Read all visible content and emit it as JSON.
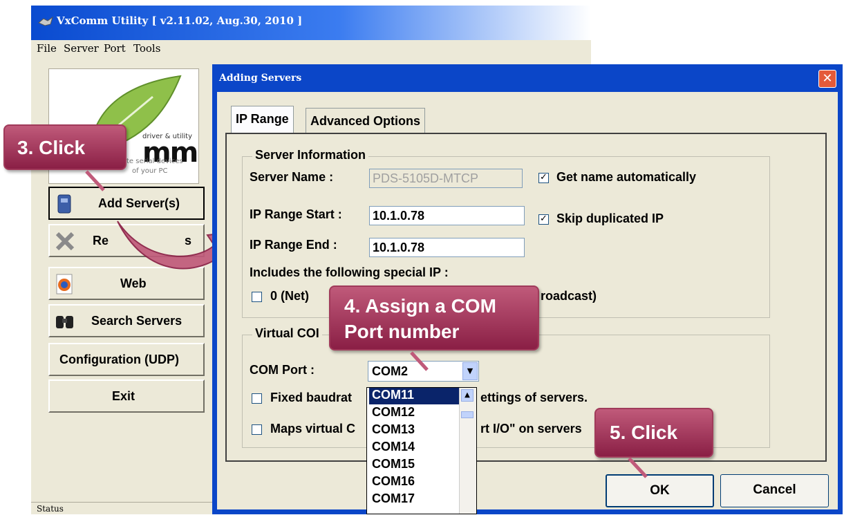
{
  "main_window": {
    "title": "VxComm Utility [ v2.11.02, Aug.30, 2010 ]",
    "menu": [
      "File",
      "Server",
      "Port",
      "Tools"
    ],
    "logo": {
      "tag": "driver & utility",
      "brand_partial": "mm",
      "line1": "te serial devices",
      "line2": "of your PC"
    },
    "sidebar": {
      "add_server": "Add Server(s)",
      "remove_partial_left": "Re",
      "remove_partial_right": "s",
      "web": "Web",
      "search_servers": "Search Servers",
      "configuration": "Configuration (UDP)",
      "exit": "Exit"
    },
    "status": "Status"
  },
  "dialog": {
    "title": "Adding Servers",
    "tabs": [
      "IP Range",
      "Advanced Options"
    ],
    "server_info": {
      "group_title": "Server Information",
      "server_name_label": "Server Name :",
      "server_name_value": "PDS-5105D-MTCP",
      "get_name_auto": "Get name automatically",
      "ip_start_label": "IP Range Start :",
      "ip_start_value": "10.1.0.78",
      "skip_dup": "Skip duplicated IP",
      "ip_end_label": "IP Range End :",
      "ip_end_value": "10.1.0.78",
      "special_ip_label": "Includes the following special IP :",
      "net_option": "0 (Net)",
      "broadcast_partial": "roadcast)"
    },
    "virtual_com": {
      "group_title_partial": "Virtual COI",
      "com_port_label": "COM Port :",
      "com_port_value": "COM2",
      "fixed_baud_left": "Fixed baudrat",
      "fixed_baud_right": "ettings of servers.",
      "maps_left": "Maps virtual C",
      "maps_right": "rt I/O\" on servers"
    },
    "dropdown_options": [
      "COM11",
      "COM12",
      "COM13",
      "COM14",
      "COM15",
      "COM16",
      "COM17"
    ],
    "ok": "OK",
    "cancel": "Cancel",
    "checkbox_mark": "✓"
  },
  "callouts": {
    "step3": "3. Click",
    "step4_line1": "4. Assign a COM",
    "step4_line2": "Port number",
    "step5": "5. Click"
  }
}
